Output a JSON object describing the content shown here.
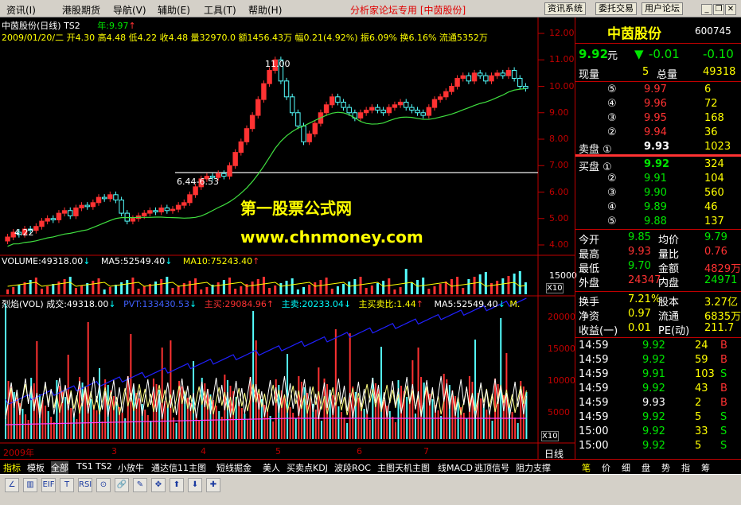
{
  "menu": {
    "items": [
      "资讯(I)",
      "港股期货",
      "导航(V)",
      "辅助(E)",
      "工具(T)",
      "帮助(H)"
    ],
    "title": "分析家论坛专用 [中茵股份]",
    "buttons": [
      "资讯系统",
      "委托交易",
      "用户论坛"
    ]
  },
  "chart": {
    "header": "中茵股份(日线) TS2",
    "year_line": "年:9.97",
    "info": "2009/01/20/二 开4.30 高4.48 低4.22 收4.48 量32970.0 额1456.43万 幅0.21(4.92%) 振6.09% 换6.16% 流通5352万",
    "y_ticks": [
      "12.00",
      "11.00",
      "10.00",
      "9.00",
      "8.00",
      "7.00",
      "6.00",
      "5.00",
      "4.00"
    ],
    "annot_high": "11.00",
    "annot_gap": "6.44-6.53",
    "annot_low": "4.22",
    "vol_header": [
      "VOLUME:49318.00",
      "MA5:52549.40",
      "MA10:75243.40"
    ],
    "vol_ticks": [
      "15000",
      "10000",
      "5000"
    ],
    "vol_unit": "X10",
    "flame_header": [
      "烈焰(VOL) 成交:49318.00",
      "PVT:133430.53",
      "主买:29084.96",
      "主卖:20233.04",
      "主买卖比:1.44",
      "MA5:52549.40",
      "M."
    ],
    "flame_ticks": [
      "20000",
      "15000",
      "10000",
      "5000"
    ],
    "x_labels": [
      "2009年",
      "3",
      "4",
      "5",
      "6",
      "7"
    ],
    "period": "日线",
    "watermark1": "第一股票公式网",
    "watermark2": "www.chnmoney.com"
  },
  "chart_data": {
    "type": "candlestick",
    "ylim": [
      4,
      12
    ],
    "closes": [
      4.3,
      4.48,
      4.4,
      4.6,
      4.55,
      4.7,
      4.9,
      5.0,
      4.95,
      5.2,
      5.3,
      5.1,
      5.4,
      5.5,
      5.45,
      5.6,
      5.8,
      5.75,
      5.9,
      5.7,
      5.2,
      4.9,
      5.0,
      5.1,
      5.2,
      5.3,
      5.25,
      5.4,
      5.3,
      5.35,
      5.5,
      5.6,
      5.9,
      6.2,
      6.5,
      6.6,
      6.55,
      6.7,
      6.6,
      7.0,
      7.5,
      7.9,
      8.4,
      8.9,
      9.5,
      10.1,
      10.6,
      11.0,
      10.2,
      9.6,
      9.0,
      8.5,
      7.9,
      8.2,
      8.6,
      9.0,
      9.3,
      9.6,
      9.4,
      9.2,
      9.0,
      8.8,
      9.0,
      9.1,
      9.2,
      9.1,
      9.0,
      9.2,
      9.3,
      9.4,
      9.2,
      9.1,
      9.0,
      8.9,
      9.2,
      9.5,
      9.6,
      9.8,
      10.0,
      10.3,
      10.4,
      10.2,
      10.5,
      10.4,
      10.2,
      10.4,
      10.5,
      10.4,
      10.6,
      10.3,
      10.0,
      9.92
    ],
    "ma_label": "年:9.97"
  },
  "quote": {
    "name": "中茵股份",
    "code": "600745",
    "price": "9.92",
    "unit": "元",
    "change": "-0.01",
    "change_pct": "-0.10",
    "now_vol_label": "现量",
    "now_vol": "5",
    "total_label": "总量",
    "total": "49318",
    "asks": [
      [
        "⑤",
        "9.97",
        "6"
      ],
      [
        "④",
        "9.96",
        "72"
      ],
      [
        "③",
        "9.95",
        "168"
      ],
      [
        "②",
        "9.94",
        "36"
      ]
    ],
    "ask1": [
      "卖盘 ①",
      "9.93",
      "1023"
    ],
    "bid1": [
      "买盘 ①",
      "9.92",
      "324"
    ],
    "bids": [
      [
        "②",
        "9.91",
        "104"
      ],
      [
        "③",
        "9.90",
        "560"
      ],
      [
        "④",
        "9.89",
        "46"
      ],
      [
        "⑤",
        "9.88",
        "137"
      ]
    ],
    "stats": [
      [
        "今开",
        "9.85",
        "均价",
        "9.79"
      ],
      [
        "最高",
        "9.93",
        "量比",
        "0.76"
      ],
      [
        "最低",
        "9.70",
        "金额",
        "4829万"
      ],
      [
        "外盘",
        "24347",
        "内盘",
        "24971"
      ]
    ],
    "stats2": [
      [
        "换手",
        "7.21%",
        "股本",
        "3.27亿"
      ],
      [
        "净资",
        "0.97",
        "流通",
        "6835万"
      ],
      [
        "收益(一)",
        "0.01",
        "PE(动)",
        "211.7"
      ]
    ],
    "ticks": [
      [
        "14:59",
        "9.92",
        "24",
        "B"
      ],
      [
        "14:59",
        "9.92",
        "59",
        "B"
      ],
      [
        "14:59",
        "9.91",
        "103",
        "S"
      ],
      [
        "14:59",
        "9.92",
        "43",
        "B"
      ],
      [
        "14:59",
        "9.93",
        "2",
        "B"
      ],
      [
        "14:59",
        "9.92",
        "5",
        "S"
      ],
      [
        "15:00",
        "9.92",
        "33",
        "S"
      ],
      [
        "15:00",
        "9.92",
        "5",
        "S"
      ]
    ]
  },
  "tabs": {
    "left": [
      "指标",
      "模板",
      "全部",
      "TS1",
      "TS2",
      "小放牛",
      "通达信11主图",
      "短线掘金",
      "美人",
      "买卖点KDJ",
      "波段ROC",
      "主图天机主图",
      "线MACD",
      "逃顶信号",
      "阻力支撑"
    ],
    "right": [
      "笔",
      "价",
      "细",
      "盘",
      "势",
      "指",
      "筹"
    ]
  },
  "toolbar": {
    "icons": [
      "line-icon",
      "bar-icon",
      "eif-icon",
      "text-icon",
      "rsi-icon",
      "mark-icon",
      "link-icon",
      "pen-icon",
      "move-icon",
      "up-icon",
      "down-icon",
      "cross-icon"
    ]
  }
}
